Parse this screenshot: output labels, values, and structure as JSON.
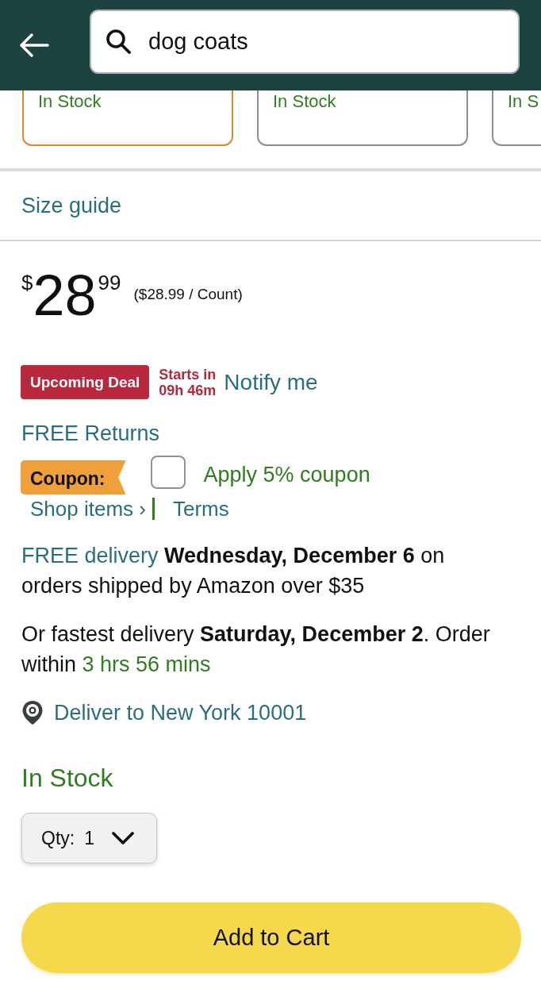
{
  "header": {
    "search": {
      "value": "dog coats"
    }
  },
  "variant_cards": [
    {
      "stock": "In Stock",
      "selected": true
    },
    {
      "stock": "In Stock",
      "selected": false
    },
    {
      "stock": "In S",
      "selected": false
    }
  ],
  "size_guide": "Size guide",
  "price": {
    "currency": "$",
    "whole": "28",
    "fraction": "99",
    "unit_price": "($28.99 / Count)"
  },
  "deal": {
    "badge": "Upcoming Deal",
    "starts_label": "Starts in",
    "countdown": "09h 46m",
    "notify": "Notify me"
  },
  "returns": "FREE Returns",
  "coupon": {
    "badge": "Coupon:",
    "checked": false,
    "label": "Apply 5% coupon",
    "links": [
      "Shop items ›",
      "Terms"
    ]
  },
  "delivery": {
    "link": "FREE delivery",
    "text": "**Wednesday, December 6** on orders shipped by Amazon over $35"
  },
  "fastest": {
    "text": "Or fastest delivery **Saturday, December 2**. Order within",
    "countdown": "3 hrs 56 mins"
  },
  "location": "Deliver to New York 10001",
  "stock": "In Stock",
  "quantity": {
    "label": "Qty:",
    "value": "1"
  },
  "add_to_cart": "Add to Cart"
}
